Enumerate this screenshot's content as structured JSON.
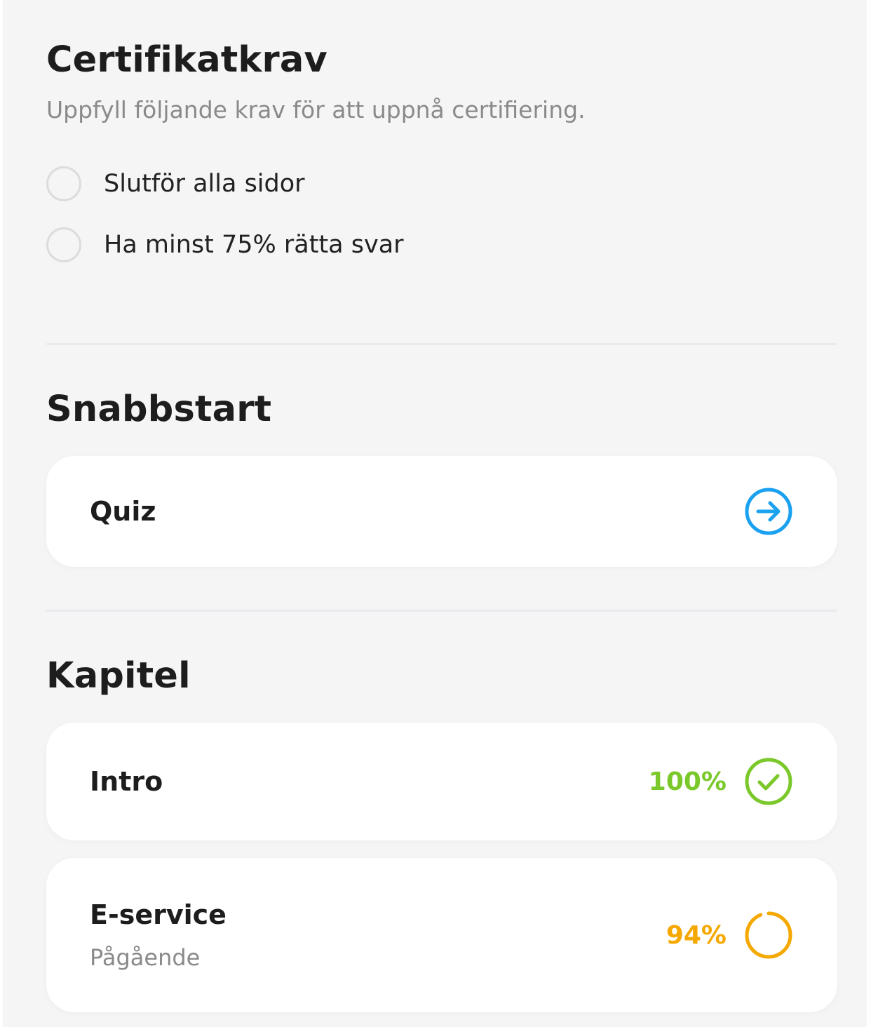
{
  "certificate": {
    "title": "Certifikatkrav",
    "subtitle": "Uppfyll följande krav för att uppnå certifiering.",
    "requirements": [
      {
        "label": "Slutför alla sidor",
        "completed": false
      },
      {
        "label": "Ha minst 75% rätta svar",
        "completed": false
      }
    ]
  },
  "quickstart": {
    "title": "Snabbstart",
    "items": [
      {
        "label": "Quiz",
        "icon": "arrow-right-circle-icon"
      }
    ]
  },
  "chapters": {
    "title": "Kapitel",
    "items": [
      {
        "label": "Intro",
        "status": "",
        "percent": "100%",
        "progress": 1.0,
        "icon": "check-circle-icon"
      },
      {
        "label": "E-service",
        "status": "Pågående",
        "percent": "94%",
        "progress": 0.94,
        "icon": "progress-ring-icon"
      }
    ]
  },
  "colors": {
    "background": "#f5f5f5",
    "card": "#ffffff",
    "accent_blue": "#1aa1f0",
    "complete_green": "#7bc82a",
    "progress_orange": "#f5a800",
    "radio_border": "#dcdcdc",
    "text_primary": "#1d1d1d",
    "text_secondary": "#8a8a8a"
  }
}
